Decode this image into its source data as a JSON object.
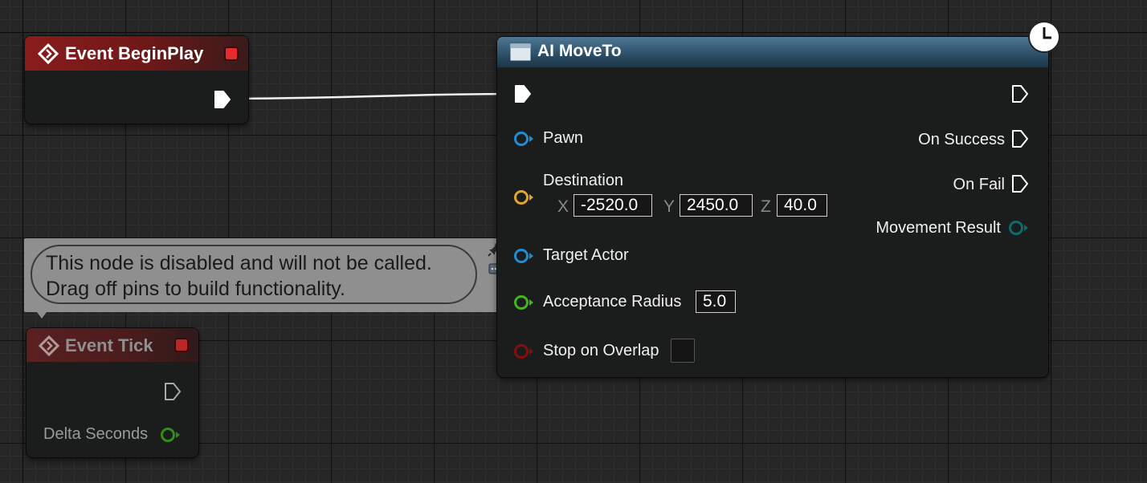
{
  "begin_play": {
    "title": "Event BeginPlay"
  },
  "event_tick": {
    "title": "Event Tick",
    "delta_seconds_label": "Delta Seconds"
  },
  "comment": {
    "line1": "This node is disabled and will not be called.",
    "line2": "Drag off pins to build functionality."
  },
  "ai_moveto": {
    "title": "AI MoveTo",
    "pawn_label": "Pawn",
    "destination_label": "Destination",
    "x_axis": "X",
    "x_value": "-2520.0",
    "y_axis": "Y",
    "y_value": "2450.0",
    "z_axis": "Z",
    "z_value": "40.0",
    "target_actor_label": "Target Actor",
    "acceptance_radius_label": "Acceptance Radius",
    "acceptance_radius_value": "5.0",
    "stop_on_overlap_label": "Stop on Overlap",
    "stop_on_overlap_checked": false,
    "on_success_label": "On Success",
    "on_fail_label": "On Fail",
    "movement_result_label": "Movement Result"
  },
  "colors": {
    "event_header": "#8a1c1c",
    "pin_object": "#1e8fd6",
    "pin_vector": "#e0a82a",
    "pin_float": "#3fb81e",
    "pin_bool": "#8a0d0d",
    "pin_enum": "#0e6b6b",
    "exec": "#ffffff"
  },
  "icons": [
    "event-diamond-icon",
    "stop-square-icon",
    "function-icon",
    "latent-clock-icon",
    "pin-icon",
    "comment-bubble-icon"
  ]
}
